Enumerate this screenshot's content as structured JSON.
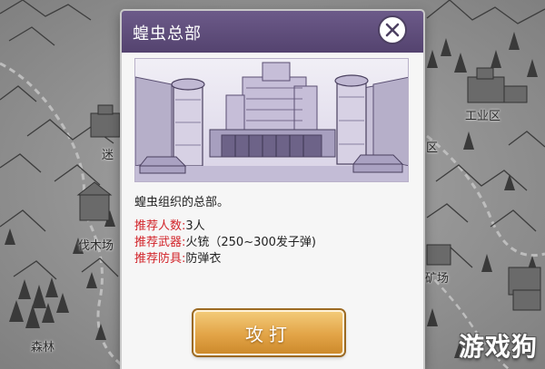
{
  "map": {
    "labels": {
      "industrial": "工业区",
      "maze_partial": "迷",
      "district_partial": "区",
      "lumber_yard": "伐木场",
      "mine_partial": "矿场",
      "forest": "森林"
    }
  },
  "dialog": {
    "title": "蝗虫总部",
    "description": "蝗虫组织的总部。",
    "info": [
      {
        "key": "推荐人数:",
        "value": "3人"
      },
      {
        "key": "推荐武器:",
        "value": "火铳（250~300发子弹)"
      },
      {
        "key": "推荐防具:",
        "value": "防弹衣"
      }
    ],
    "attack_label": "攻打"
  },
  "watermark": "游戏狗",
  "colors": {
    "header": "#5e4d7b",
    "key_text": "#d2242a",
    "button_gold": "#e2a447"
  }
}
